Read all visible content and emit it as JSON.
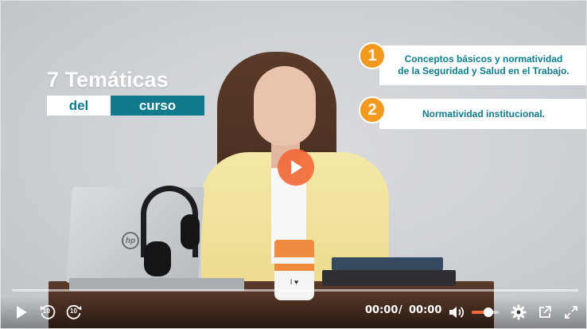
{
  "overlay": {
    "title_line": "7 Temáticas",
    "title_word1": "del",
    "title_word2": "curso"
  },
  "topics": [
    {
      "number": "1",
      "text_line1": "Conceptos básicos y normatividad",
      "text_line2": "de la Seguridad y Salud en el Trabajo."
    },
    {
      "number": "2",
      "text_line1": "Normatividad institucional.",
      "text_line2": ""
    }
  ],
  "video": {
    "laptop_brand": "hp",
    "cup_text": "I ♥"
  },
  "controls": {
    "current_time": "00:00",
    "separator": "/",
    "duration": "00:00",
    "rewind_label": "10",
    "forward_label": "10",
    "volume_level": 0.62,
    "progress": 0
  },
  "colors": {
    "accent": "#f26b3a",
    "teal": "#0f7b8a",
    "topic_number": "#f29a1f"
  },
  "icons": [
    "play-icon",
    "rewind-10-icon",
    "forward-10-icon",
    "volume-icon",
    "gear-icon",
    "popout-icon",
    "fullscreen-icon",
    "big-play-icon"
  ]
}
